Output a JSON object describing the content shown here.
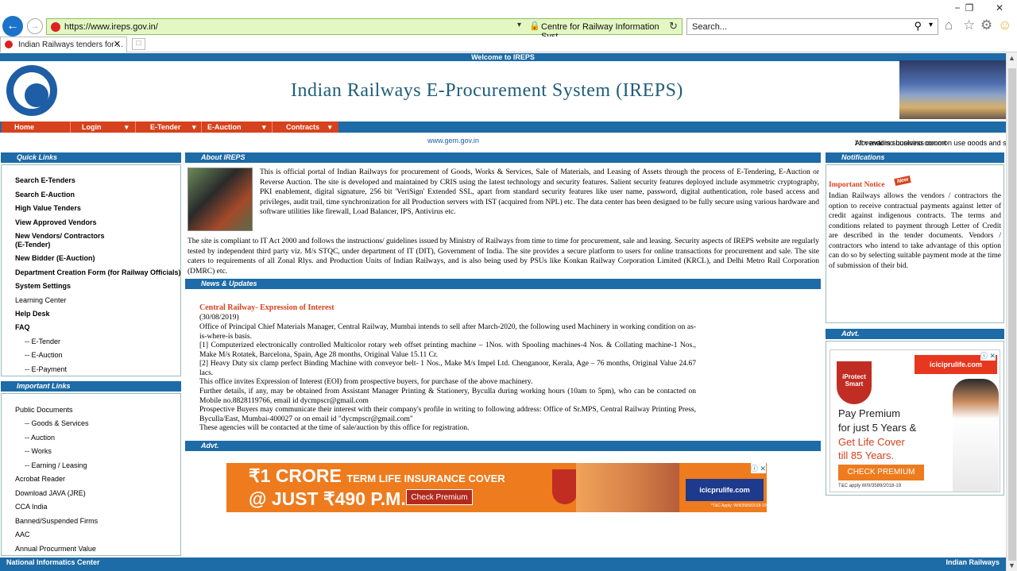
{
  "browser": {
    "url": "https://www.ireps.gov.in/",
    "site_identity": "Centre for Railway Information Syst...",
    "search_placeholder": "Search...",
    "tab_title": "Indian Railways tenders for ...",
    "window_controls": [
      "−",
      "❐",
      "✕"
    ]
  },
  "header": {
    "welcome": "Welcome to IREPS",
    "title": "Indian Railways E-Procurement System (IREPS)"
  },
  "menu": {
    "items": [
      "Home",
      "Login",
      "E-Tender",
      "E-Auction",
      "Contracts"
    ]
  },
  "marquee": {
    "text": "All vendors supplying common use goods and services to Railways are advised to get themselves registered with GeM portal (",
    "link": "www.gem.gov.in",
    "text_after": ") for availing business opport"
  },
  "quick_links": {
    "heading": "Quick Links",
    "items": [
      "Search E-Tenders",
      "Search E-Auction",
      "High Value Tenders",
      "View Approved Vendors",
      "New Vendors/ Contractors",
      "(E-Tender)",
      "New Bidder (E-Auction)",
      "Department Creation Form (for Railway Officials)",
      "System Settings",
      "Learning Center",
      "Help Desk",
      "FAQ",
      "-- E-Tender",
      "-- E-Auction",
      "-- E-Payment"
    ]
  },
  "important_links": {
    "heading": "Important Links",
    "items": [
      "Public Documents",
      "-- Goods & Services",
      "-- Auction",
      "-- Works",
      "-- Earning / Leasing",
      "Acrobat Reader",
      "Download JAVA (JRE)",
      "CCA India",
      "Banned/Suspended Firms",
      "AAC",
      "Annual Procurment Value"
    ]
  },
  "about": {
    "heading": "About IREPS",
    "para1": "This is official portal of Indian Railways for procurement of Goods, Works & Services, Sale of Materials, and Leasing of Assets through the process of E-Tendering, E-Auction or Reverse Auction. The site is developed and maintained by CRIS using the latest technology and security features. Salient security features deployed include asymmetric cryptography, PKI enablement, digital signature, 256 bit 'VeriSign' Extended SSL, apart from standard security features like user name, password, digital authentication, role based access and privileges, audit trail, time synchronization for all Production servers with IST (acquired from NPL) etc. The data center has been designed to be fully secure using various hardware and software utilities like firewall, Load Balancer, IPS, Antivirus etc.",
    "para2": "The site is compliant to IT Act 2000 and follows the instructions/ guidelines issued by Ministry of Railways from time to time for procurement, sale and leasing. Security aspects of IREPS website are regularly tested by independent third party viz. M/s STQC, under department of IT (DIT), Government of India. The site provides a secure platform to users for online transactions for procurement and sale. The site caters to requirements of all Zonal Rlys. and Production Units of Indian Railways, and is also being used by PSUs like Konkan Railway Corporation Limited (KRCL), and Delhi Metro Rail Corporation (DMRC) etc."
  },
  "news": {
    "heading": "News & Updates",
    "title": "Central Railway- Expression of Interest",
    "date": "(30/08/2019)",
    "lines": [
      "Office of Principal Chief Materials Manager, Central Railway, Mumbai intends to sell after March-2020, the following used Machinery in working condition on as-is-where-is basis.",
      "[1] Computerized electronically controlled Multicolor rotary web offset printing machine – 1Nos. with Spooling machines-4 Nos. & Collating machine-1 Nos., Make M/s Rotatek, Barcelona, Spain, Age 28 months, Original Value 15.11 Cr.",
      "[2] Heavy Duty six clamp perfect Binding Machine with conveyor belt- 1 Nos., Make M/s Impel Ltd. Chenganoor, Kerala, Age – 76 months, Original Value 24.67 lacs.",
      "This office invites Expression of Interest (EOI) from prospective buyers, for purchase of the above machinery.",
      "Further details, if any, may be obtained from Assistant Manager Printing & Stationery, Byculla during working hours (10am to 5pm), who can be contacted on Mobile no.8828119766, email id dycmpscr@gmail.com",
      "Prospective Buyers may communicate their interest with their company's profile in writing to following address: Office of Sr.MPS, Central Railway Printing Press, Byculla/East, Mumbai-400027 or on email id \"dycmpscr@gmail.com\"",
      "These agencies will be contacted at the time of sale/auction by this office for registration."
    ]
  },
  "advt": {
    "heading": "Advt.",
    "bottom": {
      "line1": "₹1 CRORE",
      "line1_small": "TERM LIFE INSURANCE COVER",
      "line2": "@ JUST ₹490 P.M.",
      "cta": "Check Premium",
      "logo": "icicprulife.com",
      "tbc": "*T&C Apply: W/II/3589/2018-19"
    }
  },
  "notifications": {
    "heading": "Notifications",
    "title": "Important Notice",
    "badge": "New",
    "body": "Indian Railways allows the vendors / contractors the option to receive contractual payments against letter of credit against indigenous contracts. The terms and conditions related to payment through Letter of Credit are described in the tender documents. Vendors / contractors who intend to take advantage of this option can do so by selecting suitable payment mode at the time of submission of their bid."
  },
  "side_ad": {
    "heading": "Advt.",
    "shield": "iProtect Smart",
    "logo": "iciciprulife.com",
    "l1": "Pay Premium",
    "l2": "for just 5 Years &",
    "l3": "Get Life Cover",
    "l4": "till 85 Years.",
    "cta": "CHECK PREMIUM",
    "tbc": "T&C apply W/II/3589/2018-19"
  },
  "footer": {
    "left": "National Informatics Center",
    "right": "Indian Railways"
  },
  "colors": {
    "brand_blue": "#1d6ba7",
    "menu_orange": "#d6421d",
    "address_green": "#e3f7c3"
  }
}
